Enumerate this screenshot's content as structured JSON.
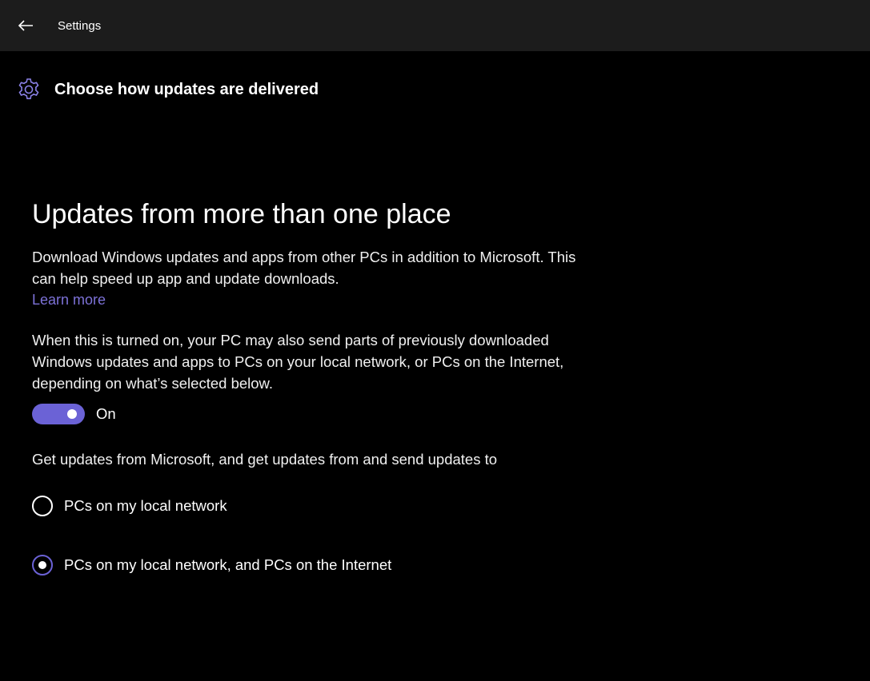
{
  "window": {
    "title": "Settings",
    "back_icon": "back-arrow-icon"
  },
  "header": {
    "icon": "gear-icon",
    "title": "Choose how updates are delivered"
  },
  "section": {
    "title": "Updates from more than one place",
    "description": "Download Windows updates and apps from other PCs in addition to Microsoft. This can help speed up app and update downloads.",
    "learn_more": "Learn more",
    "info": "When this is turned on, your PC may also send parts of previously downloaded Windows updates and apps to PCs on your local network, or PCs on the Internet, depending on what’s selected below.",
    "toggle": {
      "state": "On",
      "checked": true
    },
    "options_prompt": "Get updates from Microsoft, and get updates from and send updates to",
    "options": [
      {
        "label": "PCs on my local network",
        "selected": false
      },
      {
        "label": "PCs on my local network, and PCs on the Internet",
        "selected": true
      }
    ]
  },
  "colors": {
    "accent": "#6b62d6",
    "link": "#7d72d8",
    "titlebar": "#1c1c1c",
    "background": "#000000"
  }
}
